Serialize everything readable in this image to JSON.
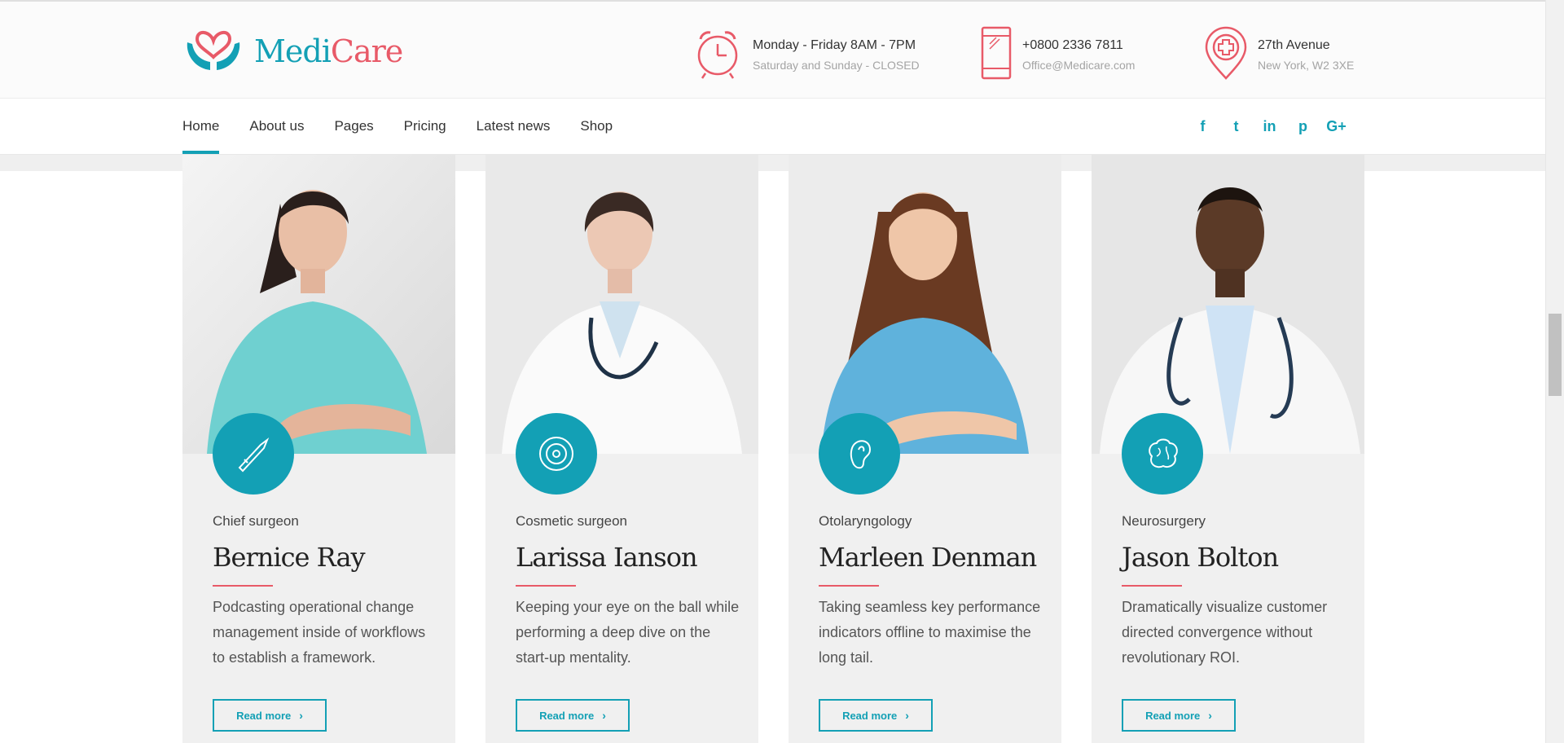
{
  "brand": {
    "part1": "Medi",
    "part2": "Care"
  },
  "header_info": [
    {
      "icon": "alarm-clock-icon",
      "line1": "Monday - Friday 8AM - 7PM",
      "line2": "Saturday and Sunday - CLOSED"
    },
    {
      "icon": "phone-icon",
      "line1": "+0800 2336 7811",
      "line2": "Office@Medicare.com"
    },
    {
      "icon": "location-pin-icon",
      "line1": "27th Avenue",
      "line2": "New York, W2 3XE"
    }
  ],
  "nav": [
    "Home",
    "About us",
    "Pages",
    "Pricing",
    "Latest news",
    "Shop"
  ],
  "social": [
    {
      "icon": "facebook-icon",
      "glyph": "f"
    },
    {
      "icon": "twitter-icon",
      "glyph": "t"
    },
    {
      "icon": "linkedin-icon",
      "glyph": "in"
    },
    {
      "icon": "pinterest-icon",
      "glyph": "p"
    },
    {
      "icon": "google-plus-icon",
      "glyph": "G+"
    }
  ],
  "team": [
    {
      "role": "Chief surgeon",
      "name": "Bernice Ray",
      "desc": "Podcasting operational change management inside of workflows to establish a framework.",
      "button": "Read more",
      "icon": "scalpel-icon"
    },
    {
      "role": "Cosmetic surgeon",
      "name": "Larissa Ianson",
      "desc": "Keeping your eye on the ball while performing a deep dive on the start-up mentality.",
      "button": "Read more",
      "icon": "disc-icon"
    },
    {
      "role": "Otolaryngology",
      "name": "Marleen Denman",
      "desc": "Taking seamless key performance indicators offline to maximise the long tail.",
      "button": "Read more",
      "icon": "ear-icon"
    },
    {
      "role": "Neurosurgery",
      "name": "Jason Bolton",
      "desc": "Dramatically visualize customer directed convergence without revolutionary ROI.",
      "button": "Read more",
      "icon": "brain-icon"
    }
  ],
  "colors": {
    "accent": "#13a0b5",
    "brand_red": "#e85a68",
    "card_bg": "#f0f0f0"
  }
}
